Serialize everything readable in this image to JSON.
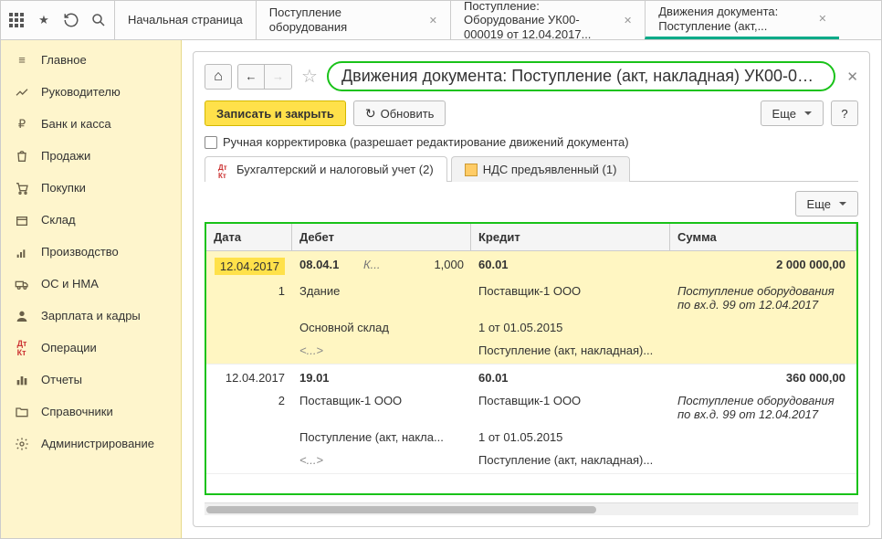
{
  "tabs": [
    {
      "label": "Начальная страница"
    },
    {
      "label": "Поступление оборудования"
    },
    {
      "label": "Поступление: Оборудование УК00-000019 от 12.04.2017..."
    },
    {
      "label": "Движения документа: Поступление (акт,..."
    }
  ],
  "sidebar": [
    {
      "label": "Главное",
      "icon": "menu"
    },
    {
      "label": "Руководителю",
      "icon": "chart"
    },
    {
      "label": "Банк и касса",
      "icon": "ruble"
    },
    {
      "label": "Продажи",
      "icon": "bag"
    },
    {
      "label": "Покупки",
      "icon": "cart"
    },
    {
      "label": "Склад",
      "icon": "box"
    },
    {
      "label": "Производство",
      "icon": "factory"
    },
    {
      "label": "ОС и НМА",
      "icon": "truck"
    },
    {
      "label": "Зарплата и кадры",
      "icon": "person"
    },
    {
      "label": "Операции",
      "icon": "dtkt"
    },
    {
      "label": "Отчеты",
      "icon": "bars"
    },
    {
      "label": "Справочники",
      "icon": "folder"
    },
    {
      "label": "Администрирование",
      "icon": "gear"
    }
  ],
  "page": {
    "title": "Движения документа: Поступление (акт, накладная) УК00-000...",
    "btn_save_close": "Записать и закрыть",
    "btn_refresh": "Обновить",
    "btn_more": "Еще",
    "btn_help": "?",
    "checkbox_label": "Ручная корректировка (разрешает редактирование движений документа)",
    "tab1": "Бухгалтерский и налоговый учет (2)",
    "tab2": "НДС предъявленный (1)"
  },
  "table": {
    "headers": {
      "date": "Дата",
      "debit": "Дебет",
      "credit": "Кредит",
      "sum": "Сумма"
    },
    "rows": [
      {
        "highlighted": true,
        "date": "12.04.2017",
        "n": "1",
        "debit_acc": "08.04.1",
        "debit_k": "К...",
        "debit_qty": "1,000",
        "debit_lines": [
          "Здание",
          "Основной склад",
          "<...>"
        ],
        "credit_acc": "60.01",
        "credit_lines": [
          "Поставщик-1 ООО",
          "1 от 01.05.2015",
          "Поступление (акт, накладная)..."
        ],
        "sum": "2 000 000,00",
        "sum_note": "Поступление оборудования по вх.д. 99 от 12.04.2017"
      },
      {
        "highlighted": false,
        "date": "12.04.2017",
        "n": "2",
        "debit_acc": "19.01",
        "debit_k": "",
        "debit_qty": "",
        "debit_lines": [
          "Поставщик-1 ООО",
          "Поступление (акт, накла...",
          "<...>"
        ],
        "credit_acc": "60.01",
        "credit_lines": [
          "Поставщик-1 ООО",
          "1 от 01.05.2015",
          "Поступление (акт, накладная)..."
        ],
        "sum": "360 000,00",
        "sum_note": "Поступление оборудования по вх.д. 99 от 12.04.2017"
      }
    ]
  }
}
